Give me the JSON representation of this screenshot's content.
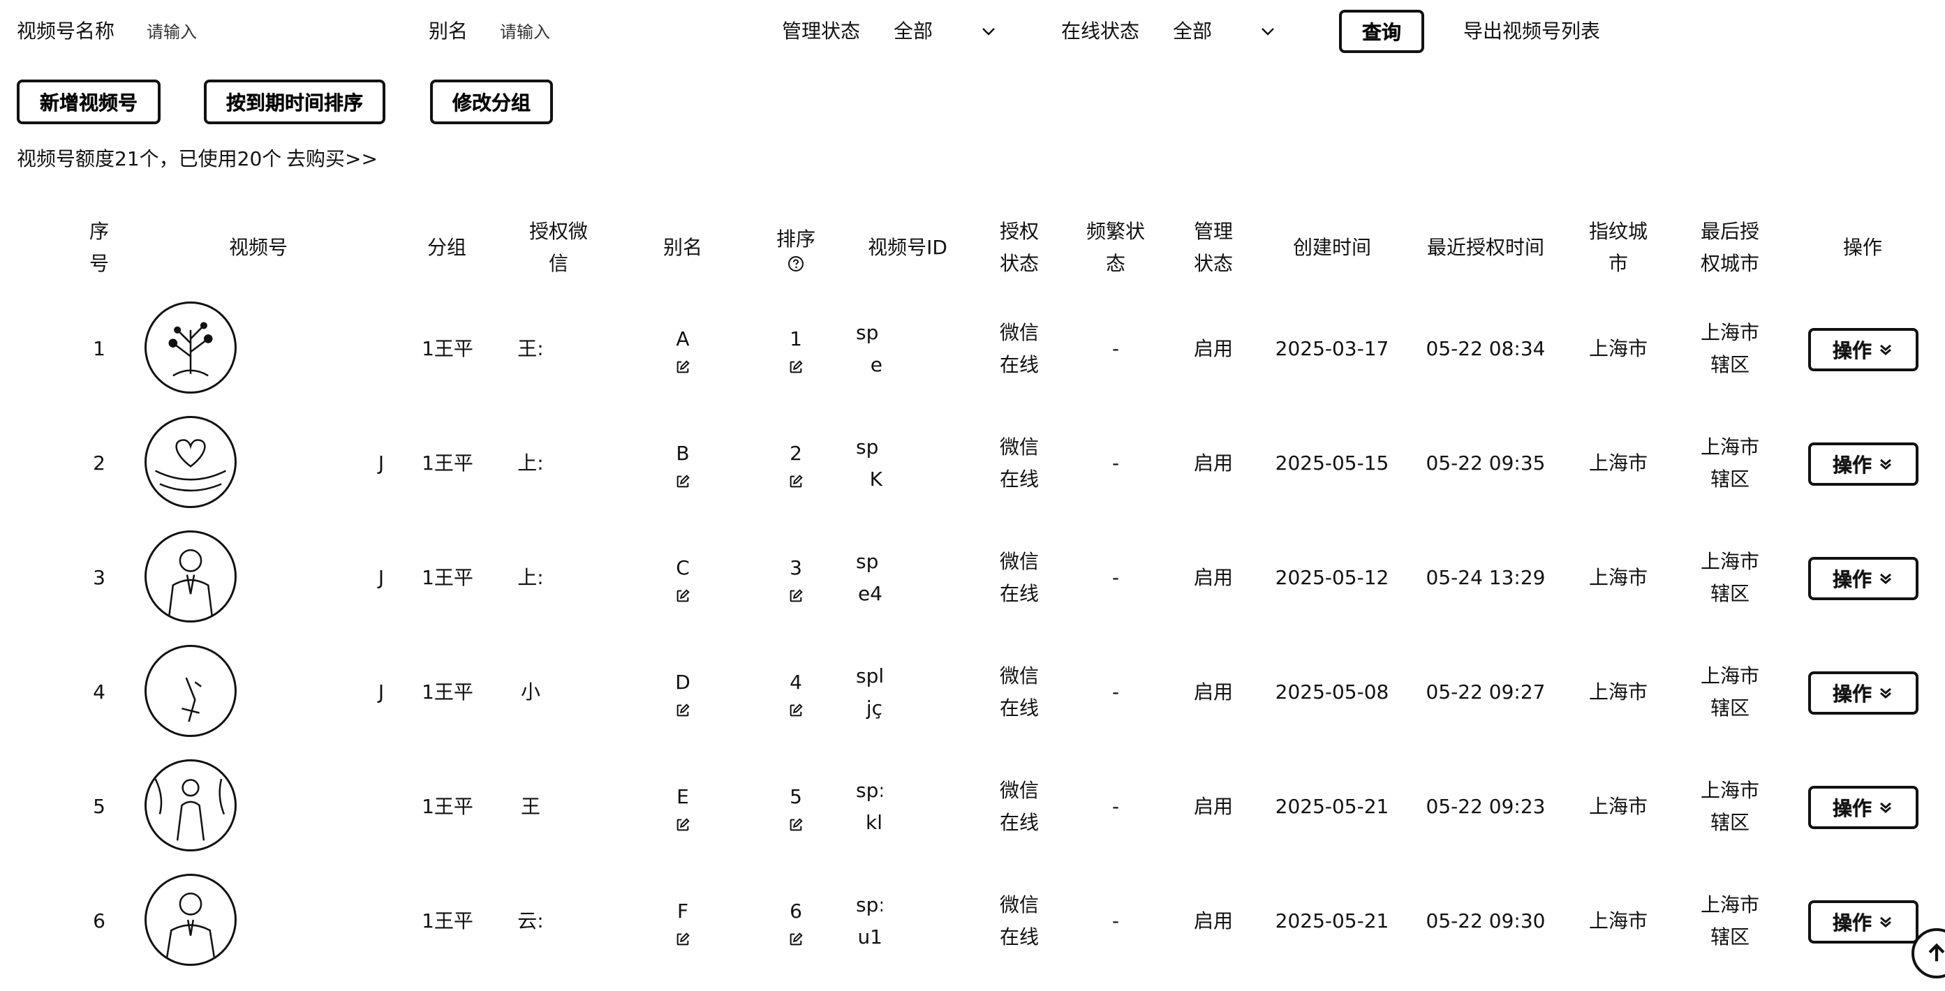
{
  "filters": {
    "name_label": "视频号名称",
    "name_placeholder": "请输入",
    "alias_label": "别名",
    "alias_placeholder": "请输入",
    "manage_status_label": "管理状态",
    "manage_status_value": "全部",
    "online_status_label": "在线状态",
    "online_status_value": "全部",
    "query_button": "查询",
    "export_link": "导出视频号列表"
  },
  "actions": {
    "add_button": "新增视频号",
    "sort_button": "按到期时间排序",
    "group_button": "修改分组"
  },
  "quota": {
    "text": "视频号额度21个，已使用20个",
    "buy_link": "去购买>>"
  },
  "table": {
    "headers": {
      "index": [
        "序",
        "号"
      ],
      "channel": [
        "视频号"
      ],
      "group": [
        "分组"
      ],
      "auth_wechat": [
        "授权微",
        "信"
      ],
      "alias": [
        "别名"
      ],
      "sort": [
        "排序"
      ],
      "channel_id": [
        "视频号ID"
      ],
      "auth_status": [
        "授权",
        "状态"
      ],
      "frequent_status": [
        "频繁状",
        "态"
      ],
      "manage_status": [
        "管理",
        "状态"
      ],
      "created_time": [
        "创建时间"
      ],
      "last_auth_time": [
        "最近授权时间"
      ],
      "fingerprint_city": [
        "指纹城",
        "市"
      ],
      "last_auth_city": [
        "最后授",
        "权城市"
      ],
      "operation": [
        "操作"
      ]
    },
    "rows": [
      {
        "index": "1",
        "channel_tail": "",
        "group": "1王平",
        "wechat": "王:",
        "alias": "A",
        "sort": "1",
        "id_top": "sp",
        "id_bottom": "e",
        "auth_status_1": "微信",
        "auth_status_2": "在线",
        "frequent": "-",
        "manage": "启用",
        "created": "2025-03-17",
        "last_auth": "05-22 08:34",
        "fp_city": "上海市",
        "last_city_1": "上海市",
        "last_city_2": "辖区",
        "op": "操作"
      },
      {
        "index": "2",
        "channel_tail": "J",
        "group": "1王平",
        "wechat": "上:",
        "alias": "B",
        "sort": "2",
        "id_top": "sp",
        "id_bottom": "K",
        "auth_status_1": "微信",
        "auth_status_2": "在线",
        "frequent": "-",
        "manage": "启用",
        "created": "2025-05-15",
        "last_auth": "05-22 09:35",
        "fp_city": "上海市",
        "last_city_1": "上海市",
        "last_city_2": "辖区",
        "op": "操作"
      },
      {
        "index": "3",
        "channel_tail": "J",
        "group": "1王平",
        "wechat": "上:",
        "alias": "C",
        "sort": "3",
        "id_top": "sp",
        "id_bottom": "e4",
        "auth_status_1": "微信",
        "auth_status_2": "在线",
        "frequent": "-",
        "manage": "启用",
        "created": "2025-05-12",
        "last_auth": "05-24 13:29",
        "fp_city": "上海市",
        "last_city_1": "上海市",
        "last_city_2": "辖区",
        "op": "操作"
      },
      {
        "index": "4",
        "channel_tail": "J",
        "group": "1王平",
        "wechat": "小",
        "alias": "D",
        "sort": "4",
        "id_top": "spl",
        "id_bottom": "jç",
        "auth_status_1": "微信",
        "auth_status_2": "在线",
        "frequent": "-",
        "manage": "启用",
        "created": "2025-05-08",
        "last_auth": "05-22 09:27",
        "fp_city": "上海市",
        "last_city_1": "上海市",
        "last_city_2": "辖区",
        "op": "操作"
      },
      {
        "index": "5",
        "channel_tail": "",
        "group": "1王平",
        "wechat": "王",
        "alias": "E",
        "sort": "5",
        "id_top": "sp:",
        "id_bottom": "kl",
        "auth_status_1": "微信",
        "auth_status_2": "在线",
        "frequent": "-",
        "manage": "启用",
        "created": "2025-05-21",
        "last_auth": "05-22 09:23",
        "fp_city": "上海市",
        "last_city_1": "上海市",
        "last_city_2": "辖区",
        "op": "操作"
      },
      {
        "index": "6",
        "channel_tail": "",
        "group": "1王平",
        "wechat": "云:",
        "alias": "F",
        "sort": "6",
        "id_top": "sp:",
        "id_bottom": "u1",
        "auth_status_1": "微信",
        "auth_status_2": "在线",
        "frequent": "-",
        "manage": "启用",
        "created": "2025-05-21",
        "last_auth": "05-22 09:30",
        "fp_city": "上海市",
        "last_city_1": "上海市",
        "last_city_2": "辖区",
        "op": "操作"
      }
    ]
  },
  "icons": {
    "dropdown": "chevron-down-icon",
    "edit": "edit-icon",
    "help": "question-circle-icon",
    "scroll_top": "arrow-up-circle-icon"
  }
}
